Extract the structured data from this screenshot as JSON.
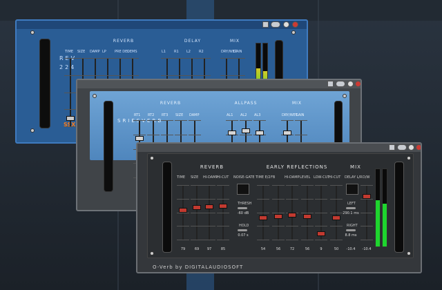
{
  "colors": {
    "rev_blue": "#2a5d95",
    "sries_blue": "#5d93c7",
    "oxverb_dark": "#2e3135",
    "accent_orange": "#f47b20",
    "meter_green": "#1ed52e",
    "led_red": "#ff3b2f"
  },
  "icons": {
    "window_buttons": [
      "minimize-icon",
      "link-icon",
      "play-icon",
      "close-icon"
    ]
  },
  "rev224": {
    "vertical_label": "REV 224",
    "badge": "SSX",
    "sections": {
      "reverb": "REVERB",
      "delay": "DELAY",
      "mix": "MIX"
    },
    "faders": [
      {
        "label": "TIME",
        "level": 0.1
      },
      {
        "label": "SIZE",
        "level": 0.1
      },
      {
        "label": "DAMP",
        "level": 0.1
      },
      {
        "label": "LP",
        "level": 0.1
      },
      {
        "label": "PRE DEL",
        "level": 0.15
      },
      {
        "label": "DEMS",
        "level": 0.15
      },
      {
        "label": "L1",
        "level": 0.1
      },
      {
        "label": "R1",
        "level": 0.1
      },
      {
        "label": "L2",
        "level": 0.1
      },
      {
        "label": "R2",
        "level": 0.1
      },
      {
        "label": "DRY/WET",
        "level": 0.1
      },
      {
        "label": "GAIN",
        "level": 0.1
      }
    ],
    "meters": [
      0.55,
      0.5
    ]
  },
  "sries": {
    "vertical_label": "SRIESVERB",
    "sections": {
      "reverb": "REVERB",
      "allpass": "ALLPASS",
      "mix": "MIX"
    },
    "faders": [
      {
        "label": "RT1",
        "level": 0.7
      },
      {
        "label": "RT2",
        "level": 0.3
      },
      {
        "label": "RT3",
        "level": 0.5
      },
      {
        "label": "SIZE",
        "level": 0.4
      },
      {
        "label": "DAMP",
        "level": 0.3
      },
      {
        "label": "AL1",
        "level": 0.8
      },
      {
        "label": "AL2",
        "level": 0.85
      },
      {
        "label": "AL3",
        "level": 0.8
      },
      {
        "label": "DRY/WET",
        "level": 0.8
      },
      {
        "label": "GAIN",
        "level": 0.5
      }
    ]
  },
  "oxverb": {
    "footer": "O-Verb by DIGITALAUDIOSOFT",
    "sections": {
      "reverb": "REVERB",
      "early": "EARLY REFLECTIONS",
      "mix": "MIX"
    },
    "reverb_faders": [
      {
        "label": "TIME",
        "value": "79",
        "level": 0.55
      },
      {
        "label": "SIZE",
        "value": "69",
        "level": 0.6
      },
      {
        "label": "HI-DAMP",
        "value": "97",
        "level": 0.62
      },
      {
        "label": "HI-CUT",
        "value": "85",
        "level": 0.63
      }
    ],
    "noise_gate": {
      "label": "NOISE-GATE",
      "thresh_label": "THRESH",
      "thresh_value": "-60 dB",
      "hold_label": "HOLD",
      "hold_value": "0.07 s"
    },
    "early_faders": [
      {
        "label": "TIME E/2",
        "value": "54",
        "level": 0.4
      },
      {
        "label": "FB",
        "value": "56",
        "level": 0.42
      },
      {
        "label": "HI-DAMP",
        "value": "72",
        "level": 0.45
      },
      {
        "label": "LEVEL",
        "value": "56",
        "level": 0.42
      },
      {
        "label": "LOW-CUT",
        "value": "9",
        "level": 0.08
      },
      {
        "label": "HI-CUT",
        "value": "50",
        "level": 0.4
      }
    ],
    "mix": {
      "delay_label": "DELAY L/R",
      "dw_label": "D/W",
      "left_label": "LEFT",
      "left_value": "290.1 ms",
      "right_label": "RIGHT",
      "right_value": "8.8 ms",
      "out_values": [
        "-10.4",
        "-10.4"
      ],
      "dw_level": 0.82
    },
    "meters": [
      0.6,
      0.55
    ]
  }
}
